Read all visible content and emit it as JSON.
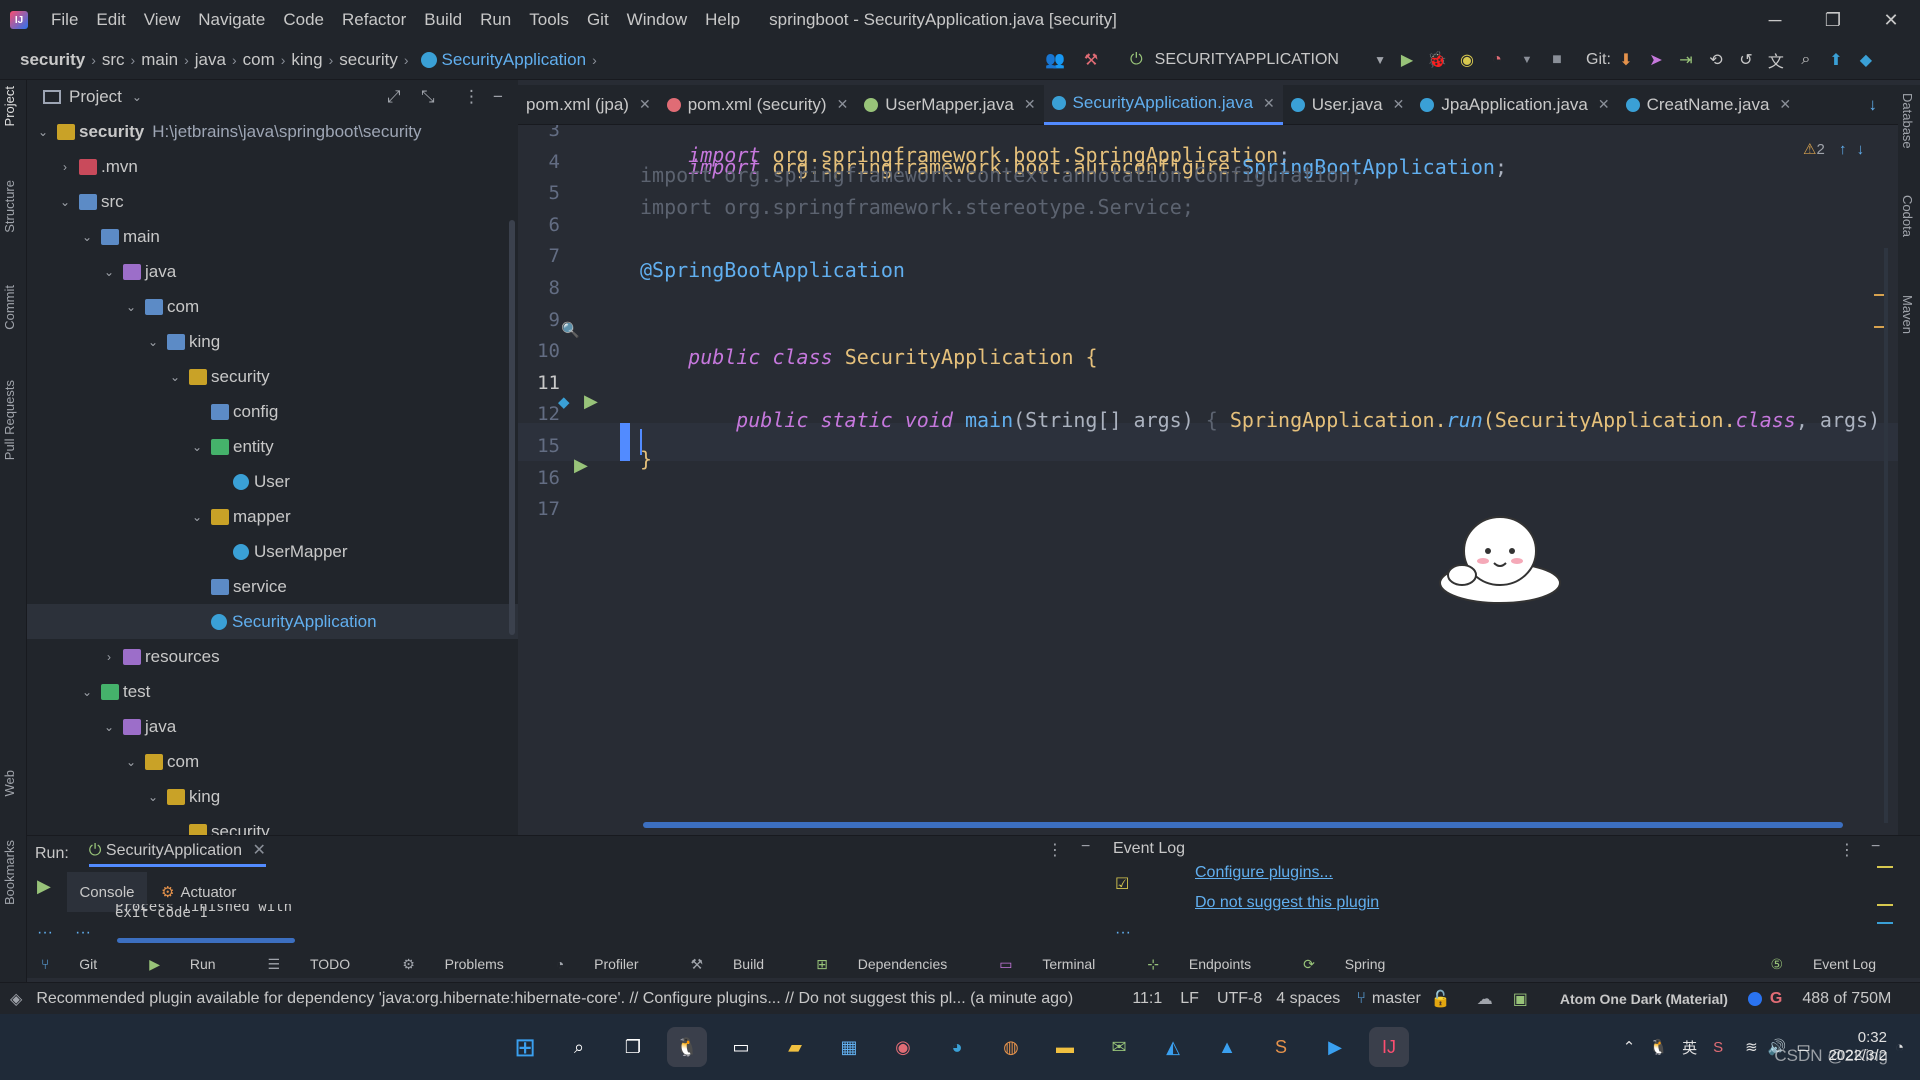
{
  "titlebar": {
    "menu": [
      "File",
      "Edit",
      "View",
      "Navigate",
      "Code",
      "Refactor",
      "Build",
      "Run",
      "Tools",
      "Git",
      "Window",
      "Help"
    ],
    "title": "springboot - SecurityApplication.java [security]",
    "minimize": "─",
    "restore": "❐",
    "close": "✕"
  },
  "breadcrumb": [
    "security",
    "src",
    "main",
    "java",
    "com",
    "king",
    "security",
    "SecurityApplication"
  ],
  "run_config": "SECURITYAPPLICATION",
  "git_label": "Git:",
  "left_strip": [
    "Project",
    "Structure",
    "Commit",
    "Pull Requests",
    "Web",
    "Bookmarks"
  ],
  "right_strip": [
    "Database",
    "Codota",
    "Maven"
  ],
  "project": {
    "header": "Project",
    "tree": [
      {
        "label": "security",
        "path": "H:\\jetbrains\\java\\springboot\\security",
        "bold": true,
        "depth": 0,
        "chev": "v",
        "icon": "folder"
      },
      {
        "label": ".mvn",
        "depth": 1,
        "chev": ">",
        "icon": "folderr"
      },
      {
        "label": "src",
        "depth": 1,
        "chev": "v",
        "icon": "folderb"
      },
      {
        "label": "main",
        "depth": 2,
        "chev": "v",
        "icon": "folderb"
      },
      {
        "label": "java",
        "depth": 3,
        "chev": "v",
        "icon": "folderp"
      },
      {
        "label": "com",
        "depth": 4,
        "chev": "v",
        "icon": "folderb"
      },
      {
        "label": "king",
        "depth": 5,
        "chev": "v",
        "icon": "folderb"
      },
      {
        "label": "security",
        "depth": 6,
        "chev": "v",
        "icon": "folder"
      },
      {
        "label": "config",
        "depth": 7,
        "chev": "",
        "icon": "folderb"
      },
      {
        "label": "entity",
        "depth": 7,
        "chev": "v",
        "icon": "folderg"
      },
      {
        "label": "User",
        "depth": 8,
        "chev": "",
        "icon": "cls"
      },
      {
        "label": "mapper",
        "depth": 7,
        "chev": "v",
        "icon": "folder"
      },
      {
        "label": "UserMapper",
        "depth": 8,
        "chev": "",
        "icon": "cls"
      },
      {
        "label": "service",
        "depth": 7,
        "chev": "",
        "icon": "folderb"
      },
      {
        "label": "SecurityApplication",
        "depth": 7,
        "chev": "",
        "icon": "cls",
        "selected": true
      },
      {
        "label": "resources",
        "depth": 3,
        "chev": ">",
        "icon": "folderp"
      },
      {
        "label": "test",
        "depth": 2,
        "chev": "v",
        "icon": "folderg"
      },
      {
        "label": "java",
        "depth": 3,
        "chev": "v",
        "icon": "folderp"
      },
      {
        "label": "com",
        "depth": 4,
        "chev": "v",
        "icon": "folder"
      },
      {
        "label": "king",
        "depth": 5,
        "chev": "v",
        "icon": "folder"
      },
      {
        "label": "security",
        "depth": 6,
        "chev": "",
        "icon": "folder"
      }
    ]
  },
  "tabs": [
    {
      "label": "pom.xml (jpa)",
      "active": false
    },
    {
      "label": "pom.xml (security)",
      "active": false
    },
    {
      "label": "UserMapper.java",
      "active": false
    },
    {
      "label": "SecurityApplication.java",
      "active": true
    },
    {
      "label": "User.java",
      "active": false
    },
    {
      "label": "JpaApplication.java",
      "active": false
    },
    {
      "label": "CreatName.java",
      "active": false
    }
  ],
  "editor": {
    "warning_count": "2",
    "lines": [
      {
        "n": "3"
      },
      {
        "n": "4"
      },
      {
        "n": "5"
      },
      {
        "n": "6"
      },
      {
        "n": "7"
      },
      {
        "n": "8"
      },
      {
        "n": "9"
      },
      {
        "n": "10"
      },
      {
        "n": "11"
      },
      {
        "n": "12"
      },
      {
        "n": "15"
      },
      {
        "n": "16"
      },
      {
        "n": "17"
      }
    ],
    "code": {
      "l3_kw": "import",
      "l3_pkg": " org.springframework.boot.",
      "l3_cls": "SpringApplication",
      "l3_end": ";",
      "l4_kw": "import",
      "l4_pkg": " org.springframework.boot.autoconfigure.",
      "l4_cls": "SpringBootApplication",
      "l4_end": ";",
      "l5": "import org.springframework.context.annotation.Configuration;",
      "l6": "import org.springframework.stereotype.Service;",
      "l8": "@SpringBootApplication",
      "l10_kw": "public class ",
      "l10_cls": "SecurityApplication",
      "l10_end": " {",
      "l12_kw": "public static void ",
      "l12_fn": "main",
      "l12_a": "(String[] args) ",
      "l12_b": "{ ",
      "l12_c": "SpringApplication.",
      "l12_run": "run",
      "l12_d": "(SecurityApplication.",
      "l12_class": "class",
      "l12_e": ", args); ",
      "l12_f": "},",
      "l16": "}"
    }
  },
  "run_panel": {
    "label": "Run:",
    "session": "SecurityApplication",
    "console_tab": "Console",
    "actuator_tab": "Actuator",
    "output": "Process finished with exit code 1"
  },
  "event_log": {
    "title": "Event Log",
    "link1": "Configure plugins...",
    "link2": "Do not suggest this plugin"
  },
  "tool_windows": [
    "Git",
    "Run",
    "TODO",
    "Problems",
    "Profiler",
    "Build",
    "Dependencies",
    "Terminal",
    "Endpoints",
    "Spring"
  ],
  "event_log_button": "Event Log",
  "status": {
    "message": "Recommended plugin available for dependency 'java:org.hibernate:hibernate-core'. // Configure plugins... // Do not suggest this pl... (a minute ago)",
    "position": "11:1",
    "line_sep": "LF",
    "encoding": "UTF-8",
    "indent": "4 spaces",
    "branch": "master",
    "theme": "Atom One Dark (Material)",
    "memory": "488 of 750M"
  },
  "taskbar": {
    "ime": "英",
    "time": "0:32",
    "date": "2022/3/2",
    "watermark": "CSDN @2King"
  }
}
